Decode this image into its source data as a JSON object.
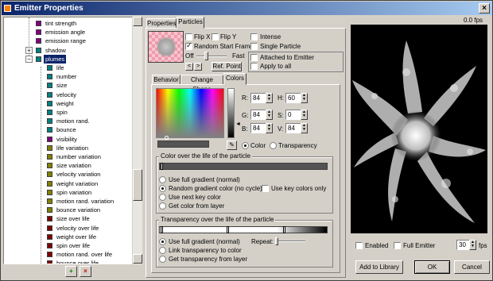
{
  "window": {
    "title": "Emitter Properties",
    "close_glyph": "×"
  },
  "tree": {
    "items": [
      {
        "label": "tint strength",
        "color": "#800080"
      },
      {
        "label": "emission angle",
        "color": "#800080"
      },
      {
        "label": "emission range",
        "color": "#800080"
      },
      {
        "label": "shadow",
        "color": "#008080"
      },
      {
        "label": "plumes",
        "color": "#008080"
      },
      {
        "label": "life",
        "color": "#008080"
      },
      {
        "label": "number",
        "color": "#008080"
      },
      {
        "label": "size",
        "color": "#008080"
      },
      {
        "label": "velocity",
        "color": "#008080"
      },
      {
        "label": "weight",
        "color": "#008080"
      },
      {
        "label": "spin",
        "color": "#008080"
      },
      {
        "label": "motion rand.",
        "color": "#008080"
      },
      {
        "label": "bounce",
        "color": "#008080"
      },
      {
        "label": "visibility",
        "color": "#800080"
      },
      {
        "label": "life variation",
        "color": "#808000"
      },
      {
        "label": "number variation",
        "color": "#808000"
      },
      {
        "label": "size variation",
        "color": "#808000"
      },
      {
        "label": "velocity variation",
        "color": "#808000"
      },
      {
        "label": "weight variation",
        "color": "#808000"
      },
      {
        "label": "spin variation",
        "color": "#808000"
      },
      {
        "label": "motion rand. variation",
        "color": "#808000"
      },
      {
        "label": "bounce variation",
        "color": "#808000"
      },
      {
        "label": "size over life",
        "color": "#800000"
      },
      {
        "label": "velocity over life",
        "color": "#800000"
      },
      {
        "label": "weight over life",
        "color": "#800000"
      },
      {
        "label": "spin over life",
        "color": "#800000"
      },
      {
        "label": "motion rand. over life",
        "color": "#800000"
      },
      {
        "label": "bounce over life",
        "color": "#800000"
      }
    ],
    "expander_shadow": "+",
    "expander_plumes": "−"
  },
  "tabs_top": [
    "Properties",
    "Particles"
  ],
  "particles": {
    "flip_x": "Flip X",
    "flip_y": "Flip Y",
    "random_start": "Random Start Frame",
    "off": "Off",
    "fast": "Fast",
    "ref_point": "Ref. Point",
    "intense": "Intense",
    "single_particle": "Single Particle",
    "attached": "Attached to Emitter",
    "apply_all": "Apply to all",
    "nav_prev": "<",
    "nav_next": ">"
  },
  "tabs_sub": [
    "Behavior",
    "Change Shape",
    "Colors"
  ],
  "colors": {
    "r_label": "R:",
    "r_val": "84",
    "g_label": "G:",
    "g_val": "84",
    "b_label": "B:",
    "b_val": "84",
    "h_label": "H:",
    "h_val": "60",
    "s_label": "S:",
    "s_val": "0",
    "v_label": "V:",
    "v_val": "84",
    "opt_color": "Color",
    "opt_transp": "Transparency",
    "group1": "Color over the life of the particle",
    "use_full": "Use full gradient (normal)",
    "random_grad": "Random gradient color (no cycle)",
    "use_next": "Use next key color",
    "get_layer": "Get color from layer",
    "key_only": "Use key colors only",
    "group2": "Transparency over the life of the particle",
    "t_use_full": "Use full gradient (normal)",
    "t_link": "Link transparency to color",
    "t_get": "Get transparency from layer",
    "repeat": "Repeat:"
  },
  "preview": {
    "fps_text": "0.0 fps",
    "enabled": "Enabled",
    "full_emitter": "Full Emitter",
    "fps_val": "30",
    "fps_unit": "fps"
  },
  "buttons": {
    "add_library": "Add to Library",
    "ok": "OK",
    "cancel": "Cancel",
    "add_icon": "+",
    "del_icon": "×"
  }
}
